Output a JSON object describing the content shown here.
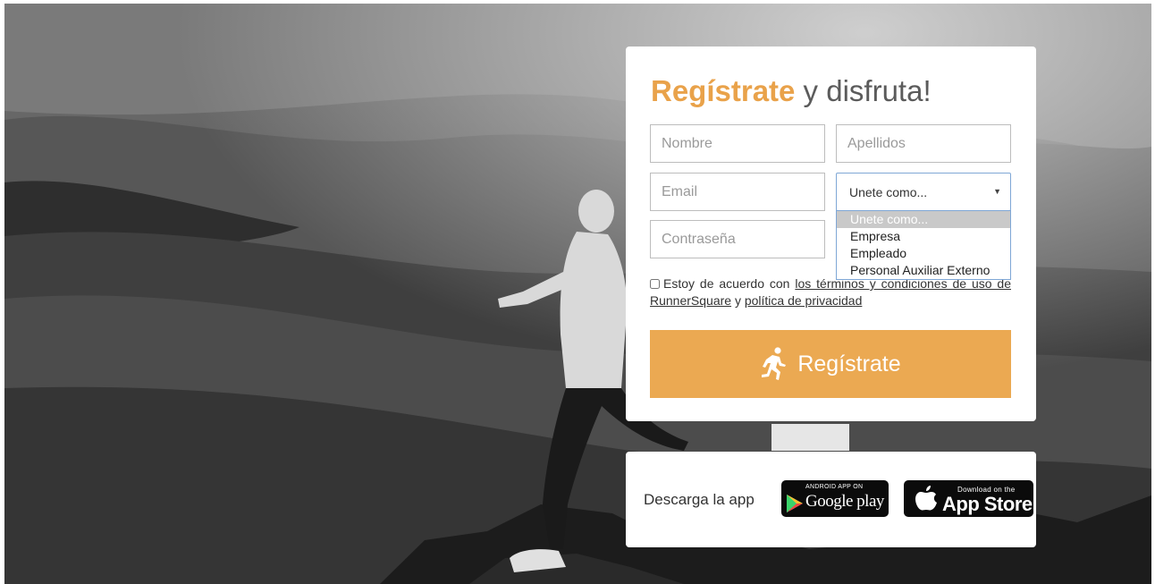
{
  "card": {
    "title_accent": "Regístrate",
    "title_rest": " y disfruta!"
  },
  "form": {
    "first_name_placeholder": "Nombre",
    "last_name_placeholder": "Apellidos",
    "email_placeholder": "Email",
    "password_placeholder": "Contraseña",
    "join_as": {
      "selected": "Unete como...",
      "options": [
        "Unete como...",
        "Empresa",
        "Empleado",
        "Personal Auxiliar Externo"
      ]
    },
    "terms": {
      "prefix": "Estoy de acuerdo con ",
      "terms_link": "los términos y condiciones de uso de RunnerSquare",
      "middle": " y ",
      "privacy_link": "política de privacidad"
    },
    "submit_label": "Regístrate",
    "submit_icon": "runner-icon"
  },
  "app_download": {
    "label": "Descarga la app",
    "google_play": {
      "small_text": "ANDROID APP ON",
      "big_text": "Google play",
      "icon": "play-triangle-icon"
    },
    "app_store": {
      "small_text": "Download on the",
      "big_text": "App Store",
      "icon": "apple-icon"
    }
  },
  "colors": {
    "accent": "#eba952",
    "title_accent": "#e9a24a",
    "title_text": "#5b5b5b",
    "card_bg": "#ffffff",
    "select_border": "#7fa7d6"
  }
}
